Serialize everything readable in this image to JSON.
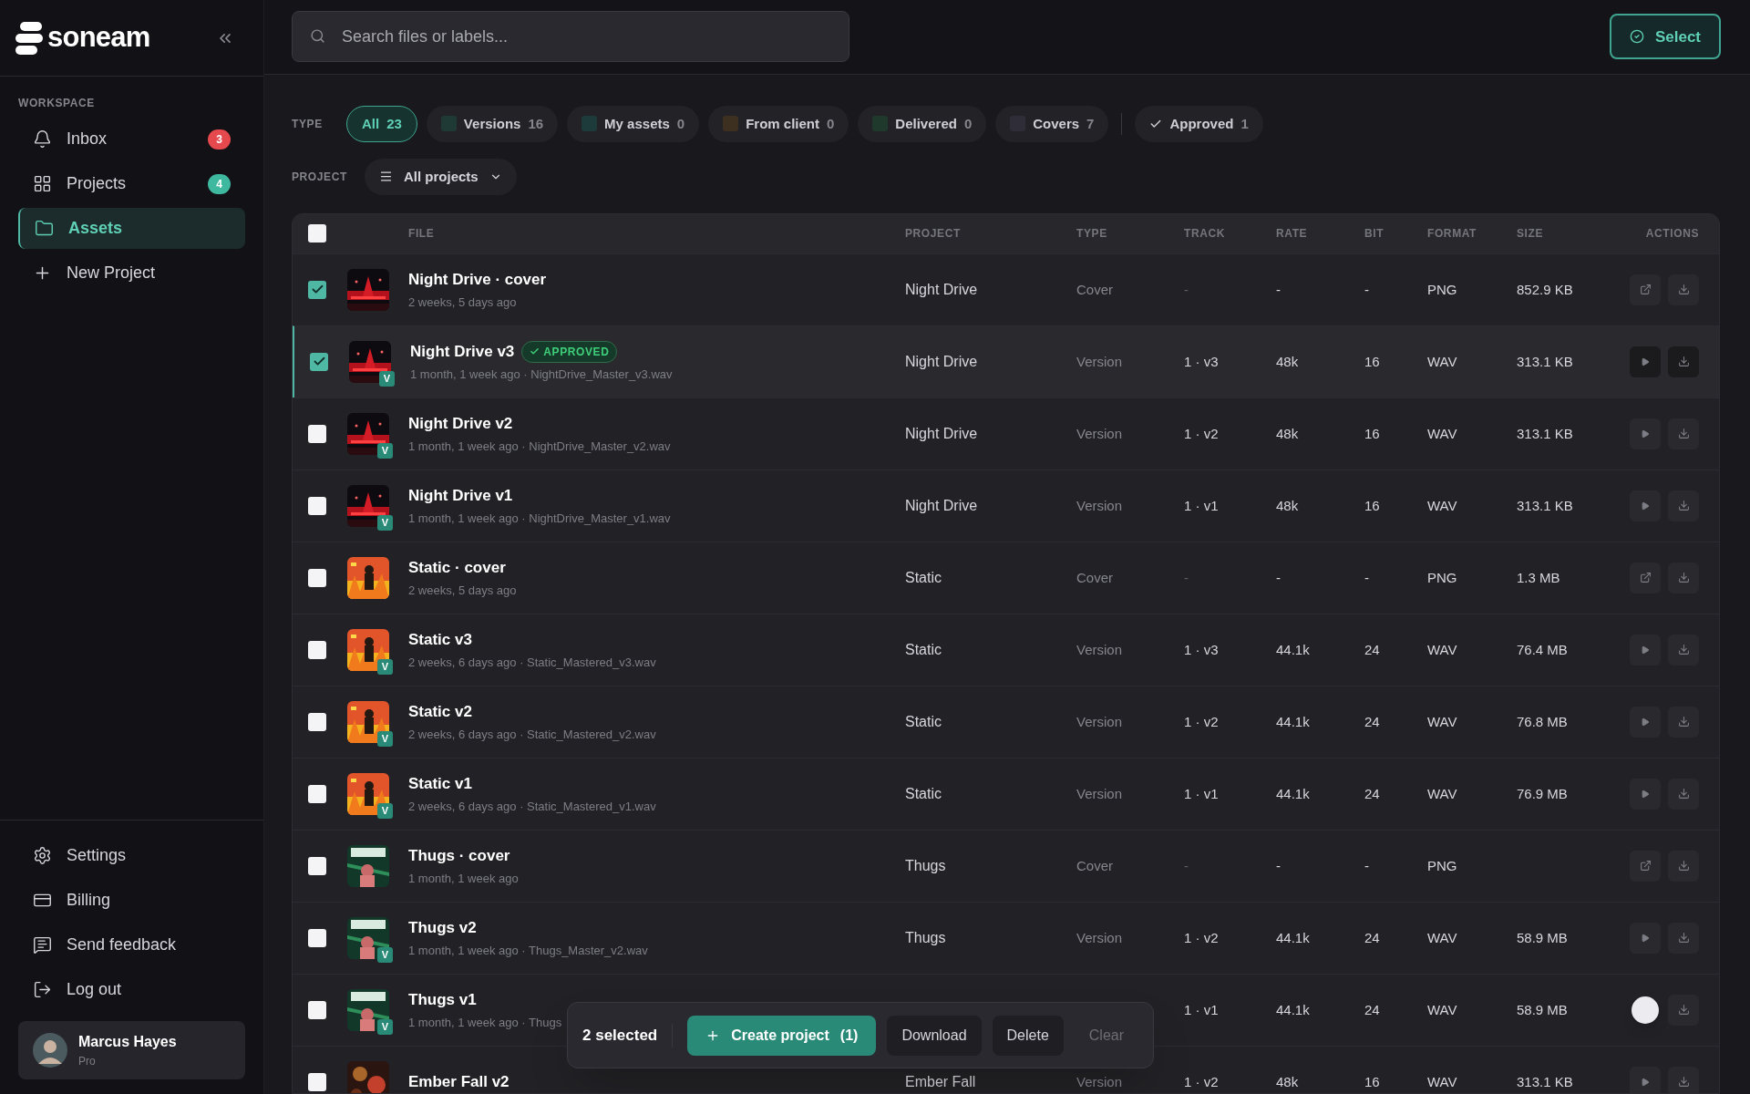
{
  "brand": {
    "name": "soneam"
  },
  "sidebar": {
    "section": "WORKSPACE",
    "items": [
      {
        "label": "Inbox",
        "kind": "bell",
        "badge": "3",
        "color": "#e5484d",
        "selected": false
      },
      {
        "label": "Projects",
        "kind": "grid",
        "badge": "4",
        "color": "#3fb8a0",
        "selected": false
      },
      {
        "label": "Assets",
        "kind": "folder",
        "selected": true
      },
      {
        "label": "New Project",
        "kind": "plus",
        "selected": false
      }
    ],
    "bottom_items": [
      {
        "label": "Settings",
        "kind": "gear"
      },
      {
        "label": "Billing",
        "kind": "card"
      },
      {
        "label": "Send feedback",
        "kind": "message"
      },
      {
        "label": "Log out",
        "kind": "logout"
      }
    ],
    "user": {
      "name": "Marcus Hayes",
      "plan": "Pro"
    }
  },
  "search": {
    "placeholder": "Search files or labels..."
  },
  "select_button": "Select",
  "type_filter": {
    "label": "TYPE",
    "chips": [
      {
        "label": "All",
        "count": "23",
        "selected": true,
        "kind": "plain"
      },
      {
        "label": "Versions",
        "count": "16",
        "selected": false,
        "kind": "swatch",
        "color": "#1f3a34"
      },
      {
        "label": "My assets",
        "count": "0",
        "selected": false,
        "kind": "swatch",
        "color": "#1d3b3a"
      },
      {
        "label": "From client",
        "count": "0",
        "selected": false,
        "kind": "swatch",
        "color": "#3d3020"
      },
      {
        "label": "Delivered",
        "count": "0",
        "selected": false,
        "kind": "swatch",
        "color": "#1f3a2c"
      },
      {
        "label": "Covers",
        "count": "7",
        "selected": false,
        "kind": "swatch",
        "color": "#2e2d38"
      },
      {
        "label": "Approved",
        "count": "1",
        "selected": false,
        "kind": "check"
      }
    ]
  },
  "project_filter": {
    "label": "PROJECT",
    "value": "All projects"
  },
  "table": {
    "columns": [
      "FILE",
      "PROJECT",
      "TYPE",
      "TRACK",
      "RATE",
      "BIT",
      "FORMAT",
      "SIZE",
      "ACTIONS"
    ],
    "all_checked": false,
    "rows": [
      {
        "checked": true,
        "highlighted": false,
        "kind": "night",
        "name": "Night Drive · cover",
        "meta": "2 weeks, 5 days ago",
        "project": "Night Drive",
        "type": "Cover",
        "track": "-",
        "rate": "-",
        "bit": "-",
        "format": "PNG",
        "size": "852.9 KB",
        "actions": [
          {
            "kind": "open"
          },
          {
            "kind": "download"
          }
        ]
      },
      {
        "checked": true,
        "highlighted": true,
        "kind": "night",
        "badge": "V",
        "tag": "APPROVED",
        "name": "Night Drive v3",
        "meta": "1 month, 1 week ago · NightDrive_Master_v3.wav",
        "project": "Night Drive",
        "type": "Version",
        "track": "1 · v3",
        "rate": "48k",
        "bit": "16",
        "format": "WAV",
        "size": "313.1 KB",
        "actions": [
          {
            "kind": "play"
          },
          {
            "kind": "download"
          }
        ]
      },
      {
        "checked": false,
        "highlighted": false,
        "kind": "night",
        "badge": "V",
        "name": "Night Drive v2",
        "meta": "1 month, 1 week ago · NightDrive_Master_v2.wav",
        "project": "Night Drive",
        "type": "Version",
        "track": "1 · v2",
        "rate": "48k",
        "bit": "16",
        "format": "WAV",
        "size": "313.1 KB",
        "actions": [
          {
            "kind": "play"
          },
          {
            "kind": "download"
          }
        ]
      },
      {
        "checked": false,
        "highlighted": false,
        "kind": "night",
        "badge": "V",
        "name": "Night Drive v1",
        "meta": "1 month, 1 week ago · NightDrive_Master_v1.wav",
        "project": "Night Drive",
        "type": "Version",
        "track": "1 · v1",
        "rate": "48k",
        "bit": "16",
        "format": "WAV",
        "size": "313.1 KB",
        "actions": [
          {
            "kind": "play"
          },
          {
            "kind": "download"
          }
        ]
      },
      {
        "checked": false,
        "highlighted": false,
        "kind": "fire",
        "name": "Static · cover",
        "meta": "2 weeks, 5 days ago",
        "project": "Static",
        "type": "Cover",
        "track": "-",
        "rate": "-",
        "bit": "-",
        "format": "PNG",
        "size": "1.3 MB",
        "actions": [
          {
            "kind": "open"
          },
          {
            "kind": "download"
          }
        ]
      },
      {
        "checked": false,
        "highlighted": false,
        "kind": "fire",
        "badge": "V",
        "name": "Static v3",
        "meta": "2 weeks, 6 days ago · Static_Mastered_v3.wav",
        "project": "Static",
        "type": "Version",
        "track": "1 · v3",
        "rate": "44.1k",
        "bit": "24",
        "format": "WAV",
        "size": "76.4 MB",
        "actions": [
          {
            "kind": "play"
          },
          {
            "kind": "download"
          }
        ]
      },
      {
        "checked": false,
        "highlighted": false,
        "kind": "fire",
        "badge": "V",
        "name": "Static v2",
        "meta": "2 weeks, 6 days ago · Static_Mastered_v2.wav",
        "project": "Static",
        "type": "Version",
        "track": "1 · v2",
        "rate": "44.1k",
        "bit": "24",
        "format": "WAV",
        "size": "76.8 MB",
        "actions": [
          {
            "kind": "play"
          },
          {
            "kind": "download"
          }
        ]
      },
      {
        "checked": false,
        "highlighted": false,
        "kind": "fire",
        "badge": "V",
        "name": "Static v1",
        "meta": "2 weeks, 6 days ago · Static_Mastered_v1.wav",
        "project": "Static",
        "type": "Version",
        "track": "1 · v1",
        "rate": "44.1k",
        "bit": "24",
        "format": "WAV",
        "size": "76.9 MB",
        "actions": [
          {
            "kind": "play"
          },
          {
            "kind": "download"
          }
        ]
      },
      {
        "checked": false,
        "highlighted": false,
        "kind": "green",
        "name": "Thugs · cover",
        "meta": "1 month, 1 week ago",
        "project": "Thugs",
        "type": "Cover",
        "track": "-",
        "rate": "-",
        "bit": "-",
        "format": "PNG",
        "actions": [
          {
            "kind": "open"
          },
          {
            "kind": "download"
          }
        ]
      },
      {
        "checked": false,
        "highlighted": false,
        "kind": "green",
        "badge": "V",
        "name": "Thugs v2",
        "meta": "1 month, 1 week ago · Thugs_Master_v2.wav",
        "project": "Thugs",
        "type": "Version",
        "track": "1 · v2",
        "rate": "44.1k",
        "bit": "24",
        "format": "WAV",
        "size": "58.9 MB",
        "actions": [
          {
            "kind": "play"
          },
          {
            "kind": "download"
          }
        ]
      },
      {
        "checked": false,
        "highlighted": false,
        "kind": "green",
        "badge": "V",
        "name": "Thugs v1",
        "meta": "1 month, 1 week ago · Thugs",
        "track": "1 · v1",
        "rate": "44.1k",
        "bit": "24",
        "format": "WAV",
        "size": "58.9 MB",
        "actions": [
          {
            "kind": "pointer"
          },
          {
            "kind": "download"
          }
        ]
      },
      {
        "checked": false,
        "highlighted": false,
        "kind": "ember",
        "name": "Ember Fall v2",
        "project": "Ember Fall",
        "type": "Version",
        "track": "1 · v2",
        "rate": "48k",
        "bit": "16",
        "format": "WAV",
        "size": "313.1 KB",
        "actions": [
          {
            "kind": "play"
          },
          {
            "kind": "download"
          }
        ]
      }
    ]
  },
  "selection_bar": {
    "count": "2 selected",
    "create": "Create project",
    "create_count": "(1)",
    "download": "Download",
    "delete": "Delete",
    "clear": "Clear"
  }
}
